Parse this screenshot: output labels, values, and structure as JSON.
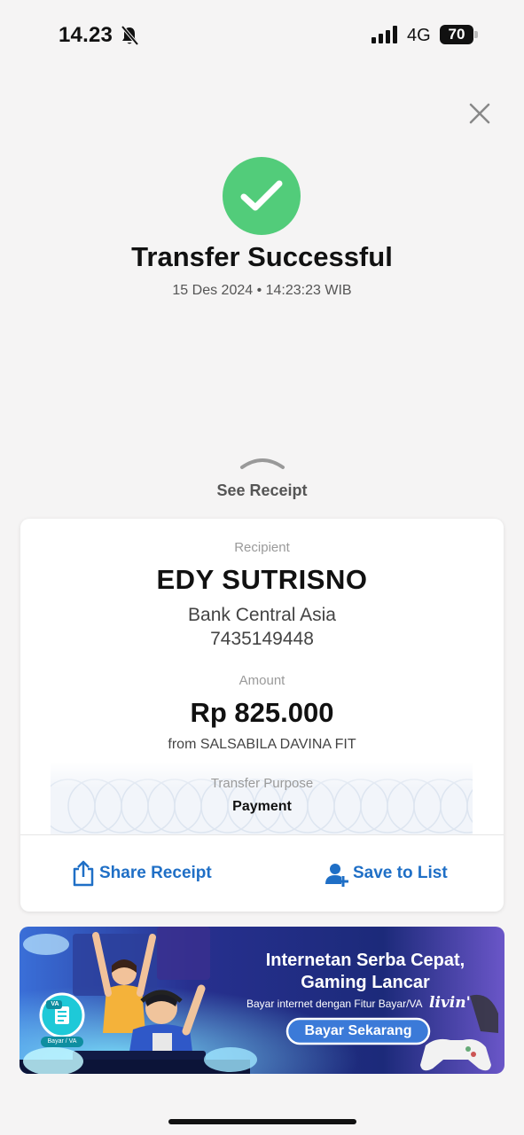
{
  "status_bar": {
    "time": "14.23",
    "network": "4G",
    "battery": "70"
  },
  "header": {
    "title": "Transfer Successful",
    "datetime": "15 Des 2024 • 14:23:23 WIB"
  },
  "sheet": {
    "handle_label": "See Receipt"
  },
  "receipt": {
    "recipient_label": "Recipient",
    "recipient_name": "EDY SUTRISNO",
    "bank_name": "Bank Central Asia",
    "account_number": "7435149448",
    "amount_label": "Amount",
    "amount": "Rp 825.000",
    "from": "from SALSABILA DAVINA FIT",
    "purpose_label": "Transfer Purpose",
    "purpose": "Payment"
  },
  "actions": {
    "share_label": "Share Receipt",
    "save_label": "Save to List"
  },
  "banner": {
    "headline_1": "Internetan Serba Cepat,",
    "headline_2": "Gaming Lancar",
    "subtitle": "Bayar internet dengan Fitur Bayar/VA",
    "brand": "livin'",
    "cta": "Bayar Sekarang",
    "badge_label": "Bayar / VA",
    "badge_text": "VA"
  },
  "colors": {
    "success": "#52cc7a",
    "action_blue": "#1f6fc6",
    "banner_bg": "#1c2a7a"
  }
}
